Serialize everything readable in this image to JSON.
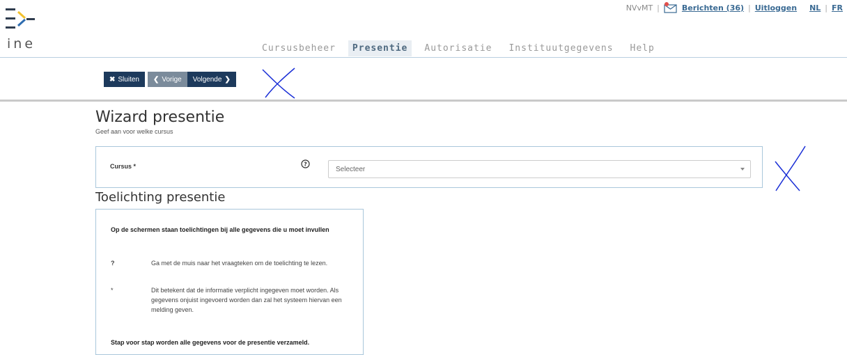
{
  "brand": {
    "logo_text": "ine"
  },
  "topbar": {
    "org": "NVvMT",
    "messages_label": "Berichten (36)",
    "logout_label": "Uitloggen",
    "lang_nl": "NL",
    "lang_fr": "FR",
    "separator": "|"
  },
  "nav": {
    "tabs": [
      {
        "label": "Cursusbeheer",
        "active": false
      },
      {
        "label": "Presentie",
        "active": true
      },
      {
        "label": "Autorisatie",
        "active": false
      },
      {
        "label": "Instituutgegevens",
        "active": false
      },
      {
        "label": "Help",
        "active": false
      }
    ]
  },
  "toolbar": {
    "close_label": "Sluiten",
    "prev_label": "Vorige",
    "next_label": "Volgende"
  },
  "page": {
    "title": "Wizard presentie",
    "subtitle": "Geef aan voor welke cursus"
  },
  "form": {
    "cursus_label": "Cursus *",
    "select_placeholder": "Selecteer"
  },
  "info": {
    "heading": "Toelichting presentie",
    "intro": "Op de schermen staan toelichtingen bij alle gegevens die u moet invullen",
    "rows": [
      {
        "key": "?",
        "text": "Ga met de muis naar het vraagteken om de toelichting te lezen."
      },
      {
        "key": "*",
        "text": "Dit betekent dat de informatie verplicht ingegeven moet worden. Als gegevens onjuist ingevoerd worden dan zal het systeem hiervan een melding geven."
      }
    ],
    "footer": "Stap voor stap worden alle gegevens voor de presentie verzameld."
  },
  "colors": {
    "nav_dark": "#1d3a5c",
    "nav_grey": "#7b8b9b",
    "border_blue": "#a9c7db",
    "logo_yellow": "#f2c12e",
    "logo_blue": "#2f6db0",
    "annotation_blue": "#1a2fd6"
  }
}
